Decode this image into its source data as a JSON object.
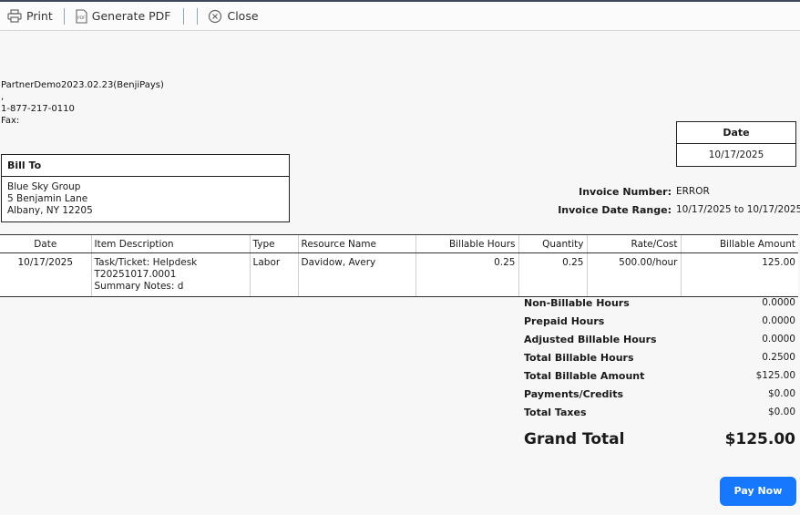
{
  "toolbar": {
    "print_label": "Print",
    "generate_pdf_label": "Generate PDF",
    "close_label": "Close"
  },
  "company": {
    "name": "PartnerDemo2023.02.23(BenjiPays)",
    "address_line": ",",
    "phone": "1-877-217-0110",
    "fax": "Fax:"
  },
  "date_box": {
    "header": "Date",
    "value": "10/17/2025"
  },
  "bill_to": {
    "header": "Bill To",
    "lines": [
      "Blue Sky Group",
      "5 Benjamin Lane",
      "Albany, NY 12205"
    ]
  },
  "invoice": {
    "number_label": "Invoice Number:",
    "number_value": "ERROR",
    "range_label": "Invoice Date Range:",
    "range_value": "10/17/2025 to 10/17/2025"
  },
  "items_table": {
    "headers": [
      "Date",
      "Item Description",
      "Type",
      "Resource Name",
      "Billable Hours",
      "Quantity",
      "Rate/Cost",
      "Billable Amount"
    ],
    "rows": [
      {
        "date": "10/17/2025",
        "description": [
          "Task/Ticket: Helpdesk",
          "T20251017.0001",
          "Summary Notes: d"
        ],
        "type": "Labor",
        "resource": "Davidow, Avery",
        "billable_hours": "0.25",
        "quantity": "0.25",
        "rate": "500.00/hour",
        "amount": "125.00"
      }
    ]
  },
  "summary": [
    {
      "label": "Non-Billable Hours",
      "value": "0.0000"
    },
    {
      "label": "Prepaid Hours",
      "value": "0.0000"
    },
    {
      "label": "Adjusted Billable Hours",
      "value": "0.0000"
    },
    {
      "label": "Total Billable Hours",
      "value": "0.2500"
    },
    {
      "label": "Total Billable Amount",
      "value": "$125.00"
    },
    {
      "label": "Payments/Credits",
      "value": "$0.00"
    },
    {
      "label": "Total Taxes",
      "value": "$0.00"
    }
  ],
  "grand_total": {
    "label": "Grand Total",
    "value": "$125.00"
  },
  "pay_now_label": "Pay Now",
  "colors": {
    "accent": "#1677ff",
    "toolbar_bg": "#fbfbfb",
    "page_bg": "#f7f7f7",
    "top_border": "#3c4a5c"
  }
}
